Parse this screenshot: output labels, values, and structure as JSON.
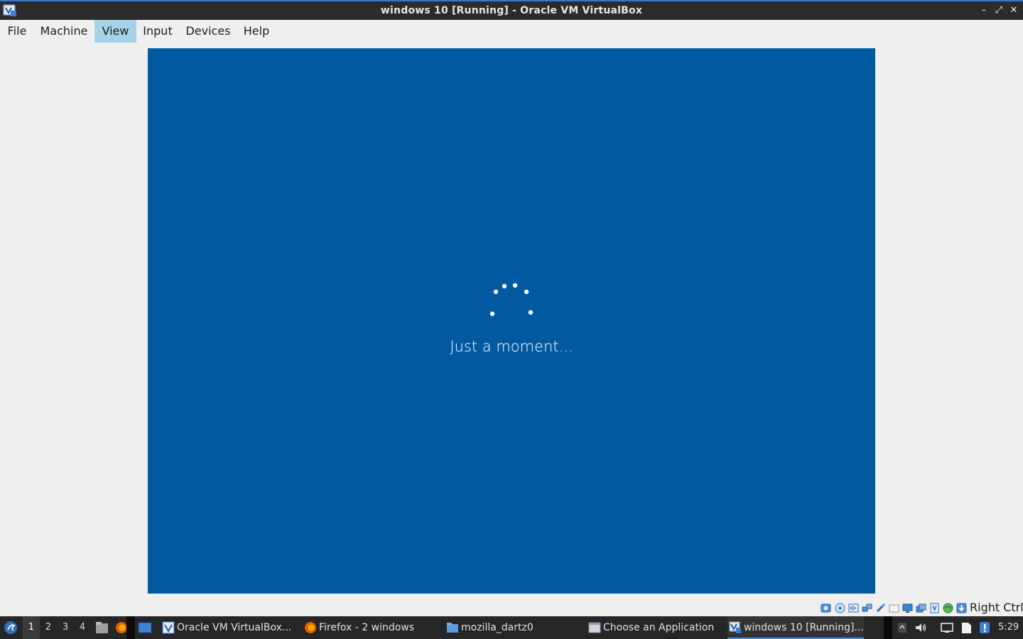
{
  "window": {
    "title": "windows 10 [Running] - Oracle VM VirtualBox",
    "min_glyph": "–",
    "max_glyph": "⤢",
    "close_glyph": "✕"
  },
  "menu": {
    "items": [
      {
        "label": "File"
      },
      {
        "label": "Machine"
      },
      {
        "label": "View",
        "active": true
      },
      {
        "label": "Input"
      },
      {
        "label": "Devices"
      },
      {
        "label": "Help"
      }
    ]
  },
  "vm": {
    "message": "Just a moment...",
    "background": "#015aa0"
  },
  "statusbar": {
    "icons": [
      "hard-disk-icon",
      "optical-drive-icon",
      "audio-icon",
      "network-icon",
      "usb-icon",
      "shared-folders-icon",
      "display-icon",
      "video-capture-icon",
      "recording-icon",
      "guest-additions-icon",
      "mouse-integration-icon",
      "keyboard-icon"
    ],
    "host_key": "Right Ctrl"
  },
  "taskbar": {
    "workspaces": [
      "1",
      "2",
      "3",
      "4"
    ],
    "current_workspace": "1",
    "tasks": [
      {
        "label": "Oracle VM VirtualBox...",
        "icon": "virtualbox-icon"
      },
      {
        "label": "Firefox - 2 windows",
        "icon": "firefox-icon"
      },
      {
        "label": "mozilla_dartz0",
        "icon": "folder-icon"
      },
      {
        "label": "Choose an Application",
        "icon": "window-icon"
      },
      {
        "label": "windows 10 [Running]...",
        "icon": "virtualbox-vm-icon",
        "active": true
      }
    ],
    "clock": "5:29"
  }
}
